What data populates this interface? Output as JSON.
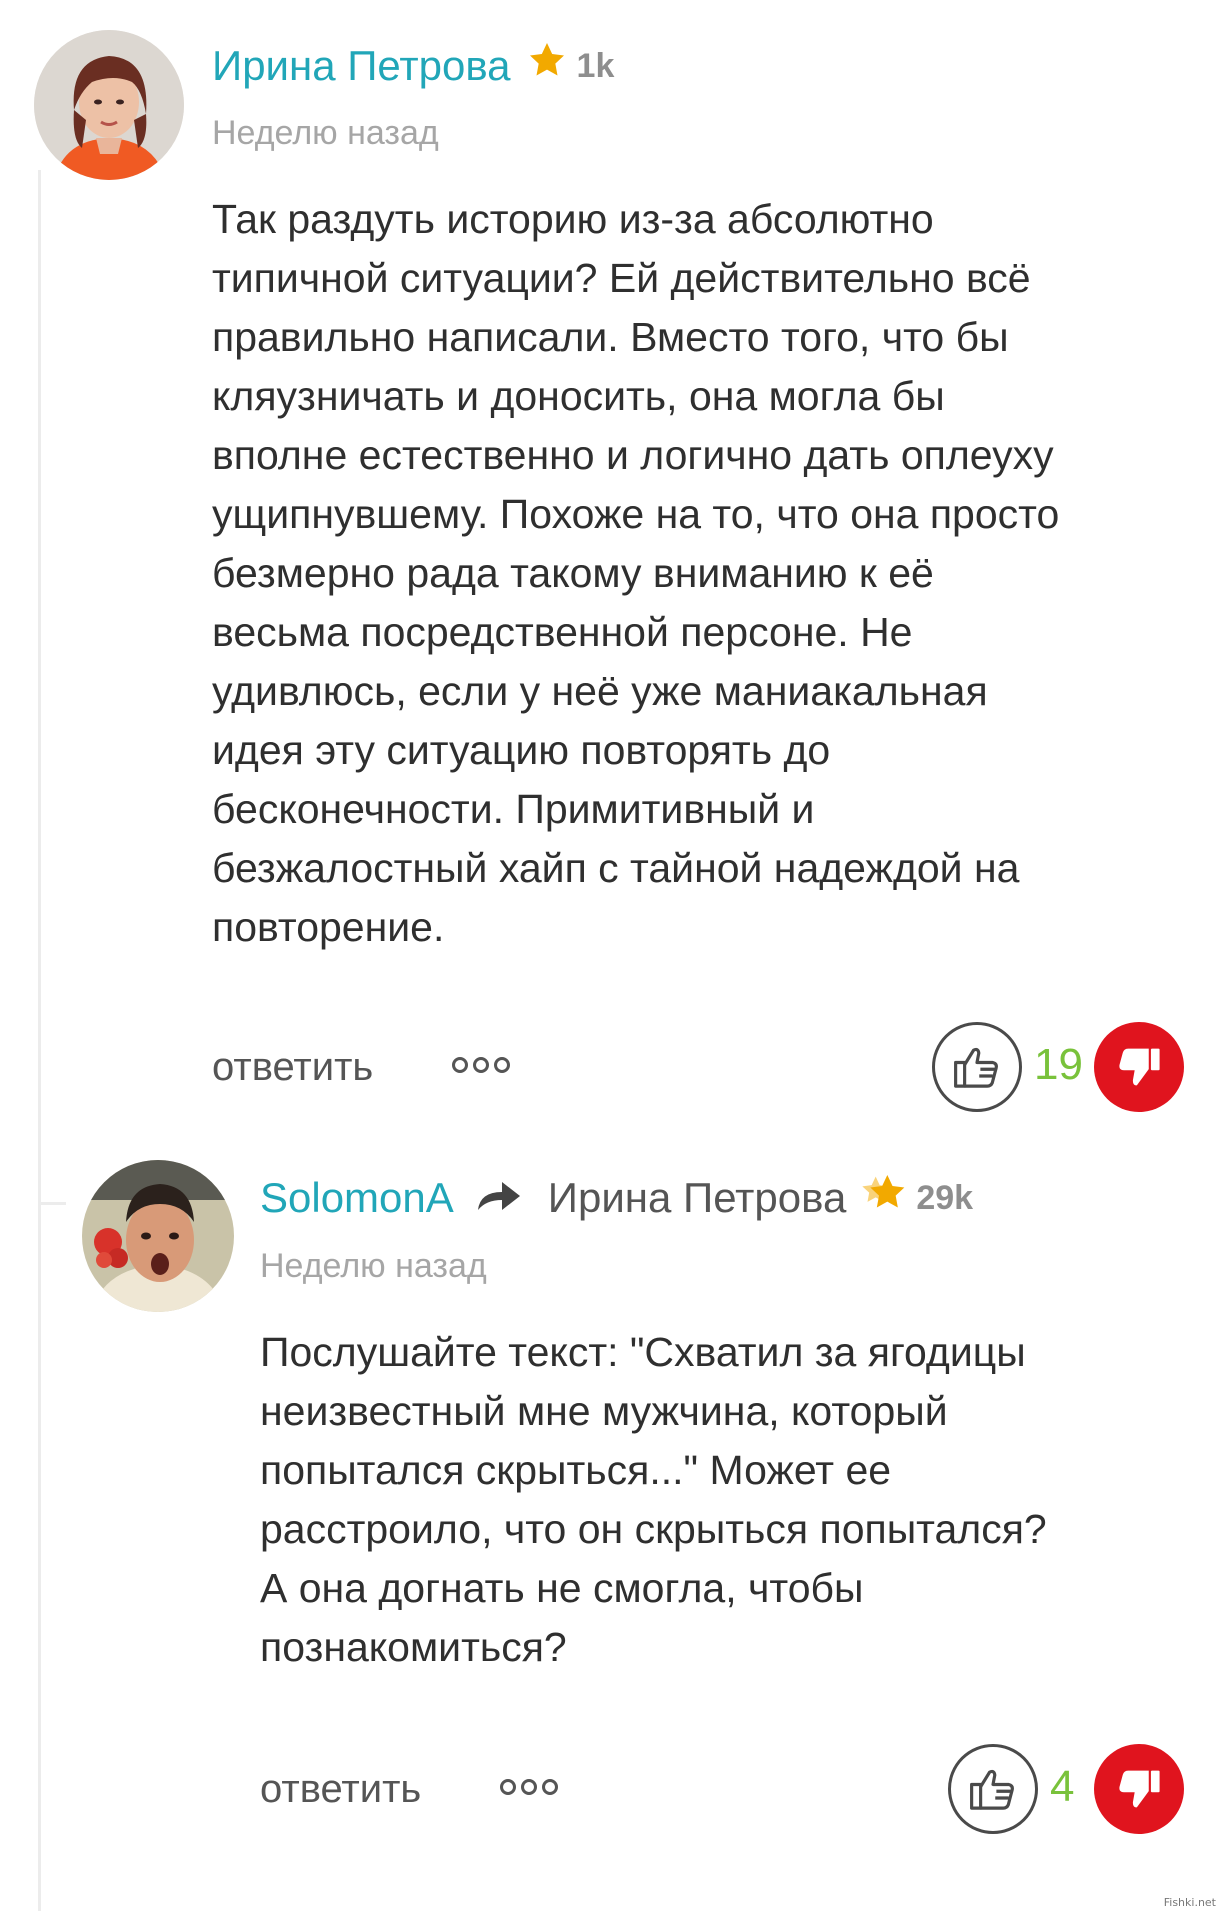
{
  "comments": [
    {
      "author": "Ирина Петрова",
      "karma": "1k",
      "timestamp": "Неделю назад",
      "text_lines": [
        "Так раздуть историю из-за абсолютно",
        "типичной ситуации? Ей действительно всё",
        "правильно написали. Вместо того, что бы",
        "кляузничать и доносить, она могла бы",
        "вполне естественно и логично дать оплеуху",
        "ущипнувшему. Похоже на то, что она просто",
        "безмерно рада такому вниманию к её",
        "весьма посредственной персоне. Не",
        "удивлюсь, если у неё уже маниакальная",
        "идея эту ситуацию повторять до",
        "бесконечности. Примитивный и",
        "безжалостный хайп с тайной надеждой на",
        "повторение."
      ],
      "reply_label": "ответить",
      "likes": "19",
      "colors": {
        "star": "#f2a900"
      }
    },
    {
      "author": "SolomonA",
      "reply_to": "Ирина Петрова",
      "karma": "29k",
      "timestamp": "Неделю назад",
      "text_lines": [
        "Послушайте текст: \"Схватил за ягодицы",
        "неизвестный мне мужчина, который",
        "попытался скрыться...\" Может ее",
        "расстроило, что он скрыться попытался?",
        "А она догнать не смогла, чтобы",
        "познакомиться?"
      ],
      "reply_label": "ответить",
      "likes": "4",
      "colors": {
        "star": "#f2a900"
      }
    }
  ],
  "icons": {
    "star": "star-icon",
    "reply_arrow": "reply-arrow-icon",
    "like": "thumbs-up-icon",
    "dislike": "thumbs-down-icon",
    "more": "more-options-icon"
  },
  "colors": {
    "author_name": "#21a6b8",
    "like_count": "#79c23b",
    "dislike_bg": "#e0141e",
    "timestamp": "#a6a6a6"
  },
  "watermark": "Fishki.net"
}
